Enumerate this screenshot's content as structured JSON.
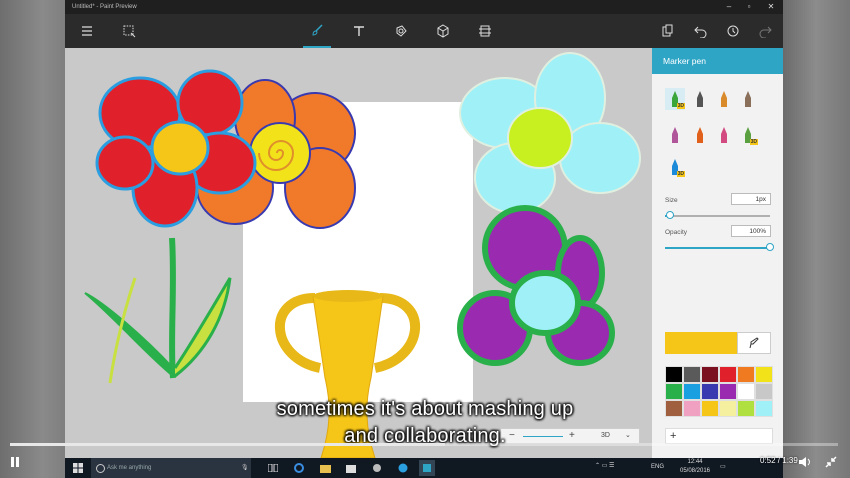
{
  "window": {
    "title": "Untitled* - Paint Preview",
    "controls": [
      "minimize-icon",
      "maximize-icon",
      "close-icon"
    ]
  },
  "toolbar": {
    "left": [
      "hamburger-menu-icon",
      "select-icon"
    ],
    "center": [
      "brush-icon",
      "text-icon",
      "stickers-icon",
      "3d-objects-icon",
      "canvas-icon"
    ],
    "right": [
      "paste-icon",
      "undo-icon",
      "history-icon",
      "redo-icon"
    ]
  },
  "panel": {
    "title": "Marker pen",
    "brushes": [
      {
        "name": "marker-3d-brush",
        "badge": "3D",
        "color": "#3aa53a"
      },
      {
        "name": "calligraphy-pen-brush",
        "badge": "",
        "color": "#555"
      },
      {
        "name": "oil-brush",
        "badge": "",
        "color": "#d98a2b"
      },
      {
        "name": "watercolor-brush",
        "badge": "",
        "color": "#8a6f5a"
      },
      {
        "name": "pencil-brush",
        "badge": "",
        "color": "#b0559a"
      },
      {
        "name": "spray-can-brush",
        "badge": "",
        "color": "#e0601c"
      },
      {
        "name": "crayon-brush",
        "badge": "",
        "color": "#d24a7f"
      },
      {
        "name": "pixel-pen-3d-brush",
        "badge": "3D",
        "color": "#5aa040"
      },
      {
        "name": "fill-3d-brush",
        "badge": "3D",
        "color": "#1c8ad8"
      }
    ],
    "size": {
      "label": "Size",
      "value": "1px",
      "level": 0.05
    },
    "opacity": {
      "label": "Opacity",
      "value": "100%",
      "level": 1.0
    },
    "current_color": "#f5c518",
    "swatches": [
      "#000000",
      "#5a5a5a",
      "#7a1020",
      "#e0202a",
      "#f07a20",
      "#f2e21a",
      "#2ab04a",
      "#1aa0e0",
      "#3a3ab0",
      "#9a2ab0",
      "#ffffff",
      "#c8c8c8",
      "#a06040",
      "#f0a0c0",
      "#f5c518",
      "#f5f0a0",
      "#b0e040",
      "#a0f0f8"
    ],
    "add_color_label": "+"
  },
  "zoom": {
    "minus": "−",
    "plus": "+",
    "mode": "3D"
  },
  "caption": {
    "line1": "sometimes it's about mashing up",
    "line2": "and collaborating."
  },
  "player": {
    "time": "0:52 / 1:39",
    "progress": 0.525
  },
  "taskbar": {
    "search_placeholder": "Ask me anything",
    "clock": "12:44",
    "date": "05/08/2016",
    "lang": "ENG"
  }
}
